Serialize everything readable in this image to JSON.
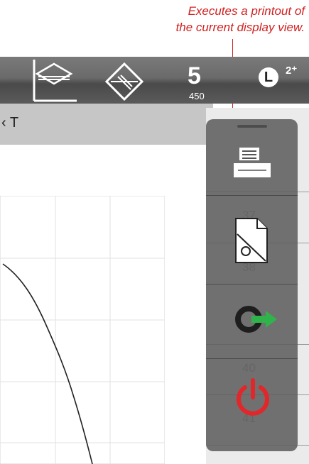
{
  "callout": {
    "line1": "Executes a printout of",
    "line2": "the current display view."
  },
  "toolbar": {
    "counter_glyph": "5",
    "counter_value": "450",
    "mode_letter": "L",
    "mode_superscript": "2⁺"
  },
  "titlebar": {
    "text": "‹ T"
  },
  "side_rows": [
    "37",
    "38",
    "40",
    "41"
  ],
  "panel_buttons": [
    "print-icon",
    "document-delete-icon",
    "export-icon",
    "power-icon"
  ],
  "colors": {
    "accent_red": "#d0201f",
    "export_green": "#2fb34a",
    "power_red": "#e2262a"
  }
}
